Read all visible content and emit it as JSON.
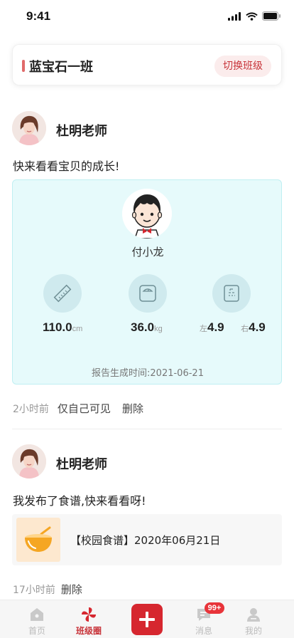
{
  "status_bar": {
    "time": "9:41"
  },
  "class_bar": {
    "name": "蓝宝石一班",
    "switch_label": "切换班级"
  },
  "posts": [
    {
      "author": "杜明老师",
      "text": "快来看看宝贝的成长!",
      "report": {
        "child_name": "付小龙",
        "height": {
          "value": "110.0",
          "unit": "cm"
        },
        "weight": {
          "value": "36.0",
          "unit": "kg"
        },
        "vision": {
          "left_label": "左",
          "left_value": "4.9",
          "right_label": "右",
          "right_value": "4.9"
        },
        "generated": "报告生成时间:2021-06-21"
      },
      "meta": {
        "time": "2小时前",
        "visibility": "仅自己可见",
        "delete": "删除"
      }
    },
    {
      "author": "杜明老师",
      "text": "我发布了食谱,快来看看呀!",
      "recipe": {
        "title": "【校园食谱】2020年06月21日"
      },
      "meta": {
        "time": "17小时前",
        "delete": "删除"
      }
    }
  ],
  "tab_bar": {
    "items": [
      {
        "label": "首页",
        "icon": "home-icon"
      },
      {
        "label": "班级圈",
        "icon": "pinwheel-icon"
      },
      {
        "label": "",
        "icon": "plus-icon"
      },
      {
        "label": "消息",
        "icon": "message-icon"
      },
      {
        "label": "我的",
        "icon": "profile-icon"
      }
    ],
    "active_index": 1,
    "message_badge": "99+"
  },
  "colors": {
    "brand": "#d6272f",
    "report_bg": "#e6fafb",
    "accent": "#e06a6a"
  }
}
